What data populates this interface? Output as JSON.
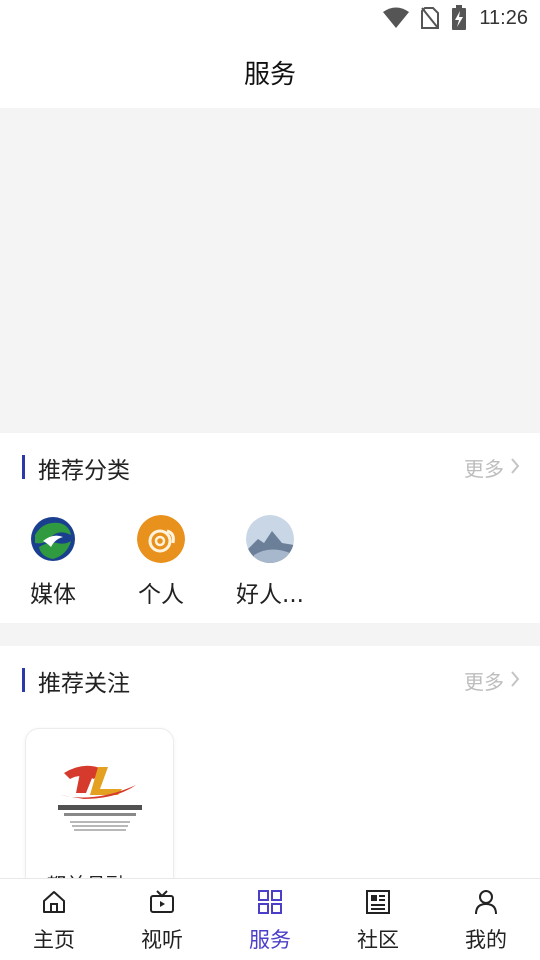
{
  "status_bar": {
    "time": "11:26",
    "icons": [
      "wifi-icon",
      "no-sim-icon",
      "battery-charging-icon"
    ]
  },
  "header": {
    "title": "服务"
  },
  "banner": {
    "background": "#f4f4f4"
  },
  "recommended_categories": {
    "title": "推荐分类",
    "more_label": "更多",
    "items": [
      {
        "label": "媒体",
        "icon": "media-avatar-icon"
      },
      {
        "label": "个人",
        "icon": "personal-avatar-icon"
      },
      {
        "label": "好人...",
        "icon": "good-people-avatar-icon"
      }
    ]
  },
  "recommended_follow": {
    "title": "推荐关注",
    "more_label": "更多",
    "cards": [
      {
        "name": "都兰县融...",
        "logo": "dulan-tv-logo"
      }
    ]
  },
  "tab_bar": {
    "active": "服务",
    "active_color": "#4b3fc9",
    "items": [
      {
        "label": "主页",
        "icon": "home-icon"
      },
      {
        "label": "视听",
        "icon": "tv-icon"
      },
      {
        "label": "服务",
        "icon": "grid-icon"
      },
      {
        "label": "社区",
        "icon": "newspaper-icon"
      },
      {
        "label": "我的",
        "icon": "user-icon"
      }
    ]
  }
}
